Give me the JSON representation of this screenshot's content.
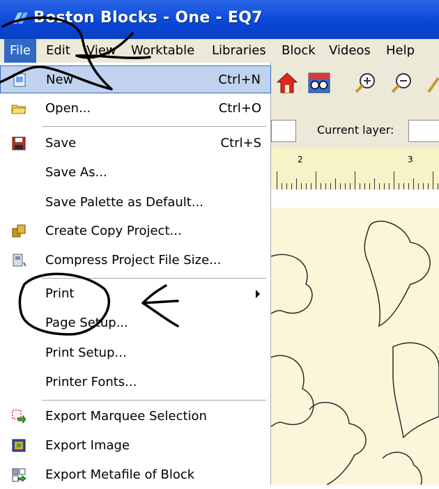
{
  "window": {
    "title": "Boston Blocks - One - EQ7"
  },
  "menubar": {
    "items": [
      "File",
      "Edit",
      "View",
      "Worktable",
      "Libraries",
      "Block",
      "Videos",
      "Help"
    ]
  },
  "file_menu": {
    "items": [
      {
        "label": "New",
        "shortcut": "Ctrl+N",
        "icon": "new-document-icon"
      },
      {
        "label": "Open...",
        "shortcut": "Ctrl+O",
        "icon": "open-folder-icon"
      },
      {
        "label": "Save",
        "shortcut": "Ctrl+S",
        "icon": "floppy-disk-icon"
      },
      {
        "label": "Save As...",
        "shortcut": ""
      },
      {
        "label": "Save Palette as Default...",
        "shortcut": ""
      },
      {
        "label": "Create Copy Project...",
        "shortcut": "",
        "icon": "copy-project-icon"
      },
      {
        "label": "Compress Project File Size...",
        "shortcut": "",
        "icon": "compress-icon"
      },
      {
        "label": "Print",
        "shortcut": ""
      },
      {
        "label": "Page Setup...",
        "shortcut": ""
      },
      {
        "label": "Print Setup...",
        "shortcut": ""
      },
      {
        "label": "Printer Fonts...",
        "shortcut": ""
      },
      {
        "label": "Export Marquee Selection",
        "shortcut": "",
        "icon": "export-marquee-icon"
      },
      {
        "label": "Export Image",
        "shortcut": "",
        "icon": "export-image-icon"
      },
      {
        "label": "Export Metafile of Block",
        "shortcut": "",
        "icon": "export-metafile-icon"
      }
    ]
  },
  "layer_bar": {
    "label": "Current layer:"
  },
  "ruler": {
    "numbers": [
      "2",
      "3"
    ]
  },
  "colors": {
    "title_bar": "#0a48d8",
    "menu_highlight": "#316ac5",
    "menu_bg": "#ece9d8",
    "canvas": "#fbf6da"
  }
}
